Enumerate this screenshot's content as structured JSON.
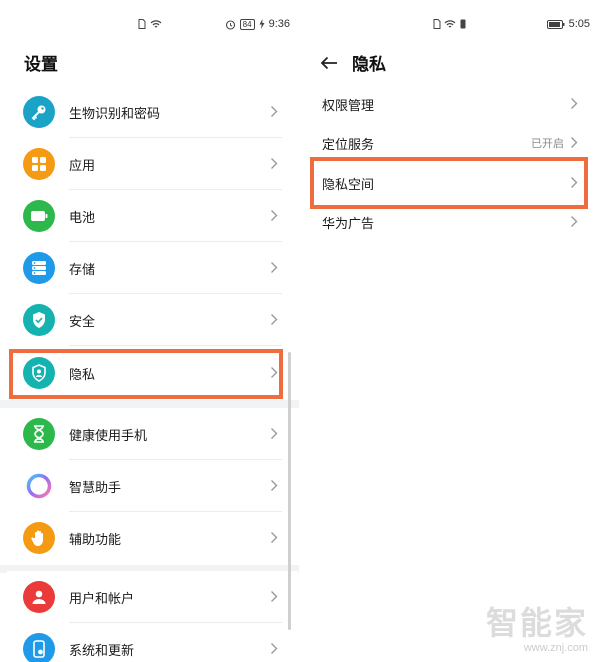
{
  "left_screen": {
    "status_bar": {
      "time": "9:36",
      "battery": "84"
    },
    "title": "设置",
    "sections": [
      {
        "items": [
          {
            "label": "生物识别和密码",
            "icon": "key-icon",
            "color": "#1aa3c7"
          },
          {
            "label": "应用",
            "icon": "apps-grid-icon",
            "color": "#f59a13"
          },
          {
            "label": "电池",
            "icon": "battery-icon",
            "color": "#2db84c"
          },
          {
            "label": "存储",
            "icon": "storage-icon",
            "color": "#1e9ae8"
          },
          {
            "label": "安全",
            "icon": "shield-check-icon",
            "color": "#14b3b0"
          },
          {
            "label": "隐私",
            "icon": "privacy-shield-icon",
            "color": "#14b3b0"
          }
        ]
      },
      {
        "items": [
          {
            "label": "健康使用手机",
            "icon": "hourglass-icon",
            "color": "#2db84c"
          },
          {
            "label": "智慧助手",
            "icon": "assistant-ring-icon",
            "color": "#9b6cf0"
          },
          {
            "label": "辅助功能",
            "icon": "hand-icon",
            "color": "#f59a13"
          }
        ]
      },
      {
        "items": [
          {
            "label": "用户和帐户",
            "icon": "user-icon",
            "color": "#ea3a3a"
          },
          {
            "label": "系统和更新",
            "icon": "phone-update-icon",
            "color": "#1e9ae8"
          }
        ]
      }
    ]
  },
  "right_screen": {
    "status_bar": {
      "time": "5:05"
    },
    "title": "隐私",
    "items": [
      {
        "label": "权限管理",
        "value": ""
      },
      {
        "label": "定位服务",
        "value": "已开启"
      },
      {
        "label": "隐私空间",
        "value": ""
      },
      {
        "label": "华为广告",
        "value": ""
      }
    ]
  },
  "highlight_color": "#ef6c3f",
  "watermark": {
    "logo": "智能家",
    "url": "www.znj.com"
  }
}
